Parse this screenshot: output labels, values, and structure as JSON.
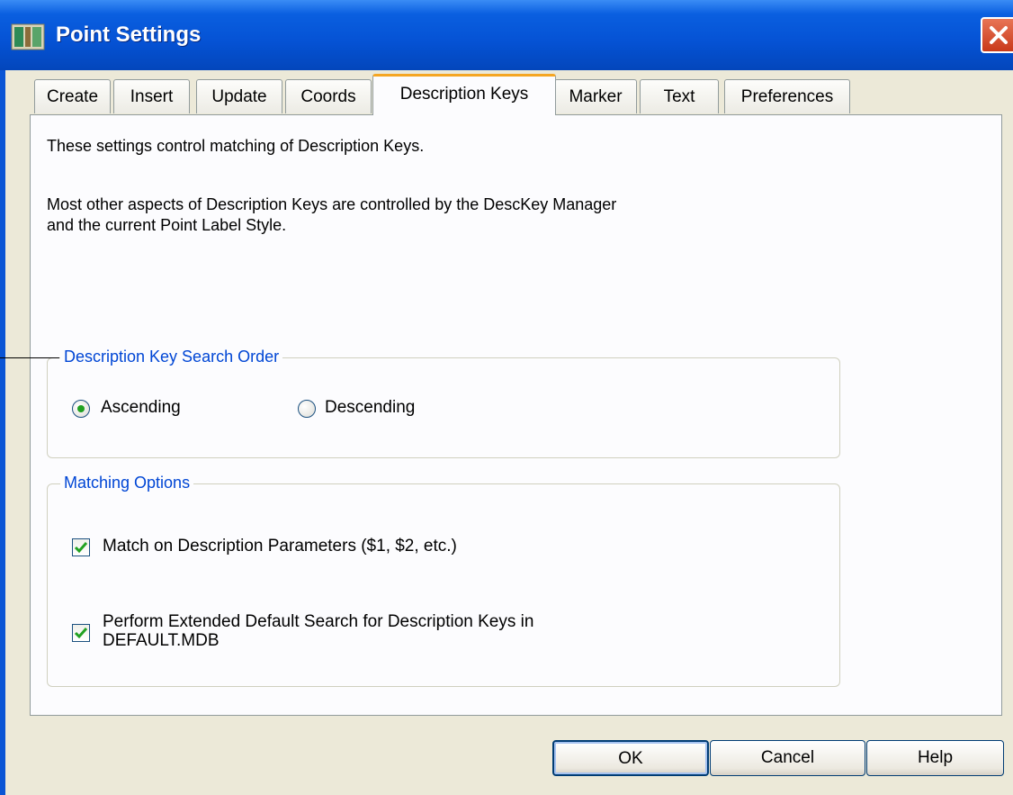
{
  "window": {
    "title": "Point Settings"
  },
  "tabs": [
    {
      "label": "Create",
      "active": false
    },
    {
      "label": "Insert",
      "active": false
    },
    {
      "label": "Update",
      "active": false
    },
    {
      "label": "Coords",
      "active": false
    },
    {
      "label": "Description Keys",
      "active": true
    },
    {
      "label": "Marker",
      "active": false
    },
    {
      "label": "Text",
      "active": false
    },
    {
      "label": "Preferences",
      "active": false
    }
  ],
  "panel": {
    "line1": "These settings control matching of Description Keys.",
    "line2": "Most other aspects of Description Keys are controlled by the DescKey Manager",
    "line3": "and the current Point Label Style."
  },
  "search_order": {
    "title": "Description Key Search Order",
    "ascending_label": "Ascending",
    "descending_label": "Descending",
    "selected": "Ascending"
  },
  "matching": {
    "title": "Matching Options",
    "option1_label": "Match on Description Parameters ($1, $2, etc.)",
    "option1_checked": true,
    "option2_line1": "Perform Extended Default Search for Description Keys in",
    "option2_line2": "DEFAULT.MDB",
    "option2_checked": true
  },
  "buttons": {
    "ok": "OK",
    "cancel": "Cancel",
    "help": "Help"
  },
  "colors": {
    "titlebar": "#0552d4",
    "group_title": "#0046d5",
    "active_tab_accent": "#f5a623",
    "check_mark": "#21a121"
  }
}
